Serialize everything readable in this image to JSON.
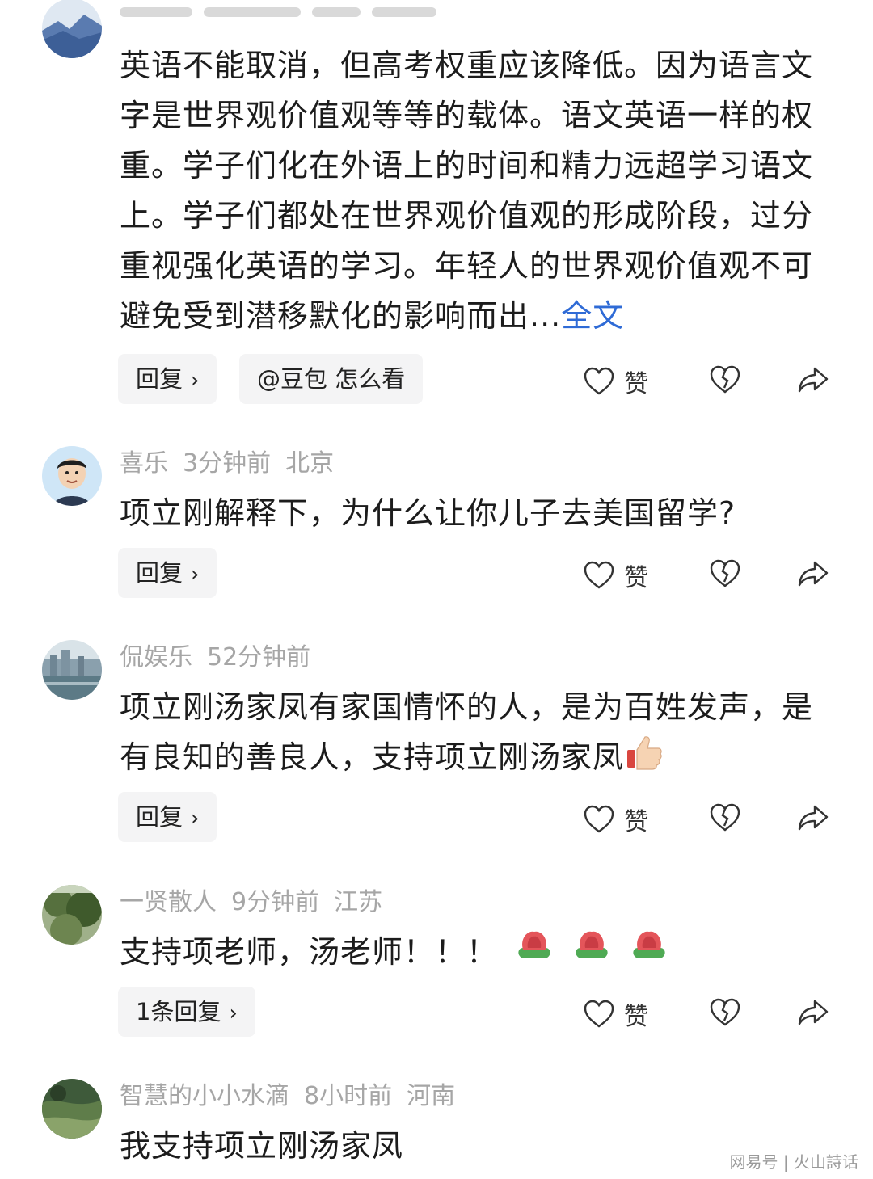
{
  "comments": [
    {
      "name": "",
      "time": "",
      "location": "",
      "text": "英语不能取消，但高考权重应该降低。因为语言文字是世界观价值观等等的载体。语文英语一样的权重。学子们化在外语上的时间和精力远超学习语文上。学子们都处在世界观价值观的形成阶段，过分重视强化英语的学习。年轻人的世界观价值观不可避免受到潜移默化的影响而出...",
      "more": "全文",
      "reply": "回复",
      "ask": "@豆包 怎么看",
      "like": "赞"
    },
    {
      "name": "喜乐",
      "time": "3分钟前",
      "location": "北京",
      "text": "项立刚解释下，为什么让你儿子去美国留学?",
      "reply": "回复",
      "like": "赞"
    },
    {
      "name": "侃娱乐",
      "time": "52分钟前",
      "location": "",
      "text": "项立刚汤家凤有家国情怀的人，是为百姓发声，是有良知的善良人，支持项立刚汤家凤",
      "reply": "回复",
      "like": "赞"
    },
    {
      "name": "一贤散人",
      "time": "9分钟前",
      "location": "江苏",
      "text": "支持项老师，汤老师！！！",
      "reply": "1条回复",
      "like": "赞"
    },
    {
      "name": "智慧的小小水滴",
      "time": "8小时前",
      "location": "河南",
      "text": "我支持项立刚汤家凤"
    }
  ],
  "chevron": "›",
  "watermark": "网易号 | 火山詩话",
  "icons": [
    "heart-icon",
    "dislike-heart-icon",
    "share-arrow-icon",
    "thumbs-up-emoji",
    "rose-emoji"
  ],
  "colors": {
    "link": "#2f6bd6",
    "meta": "#a6a6a6",
    "chip_bg": "#f4f4f5"
  }
}
